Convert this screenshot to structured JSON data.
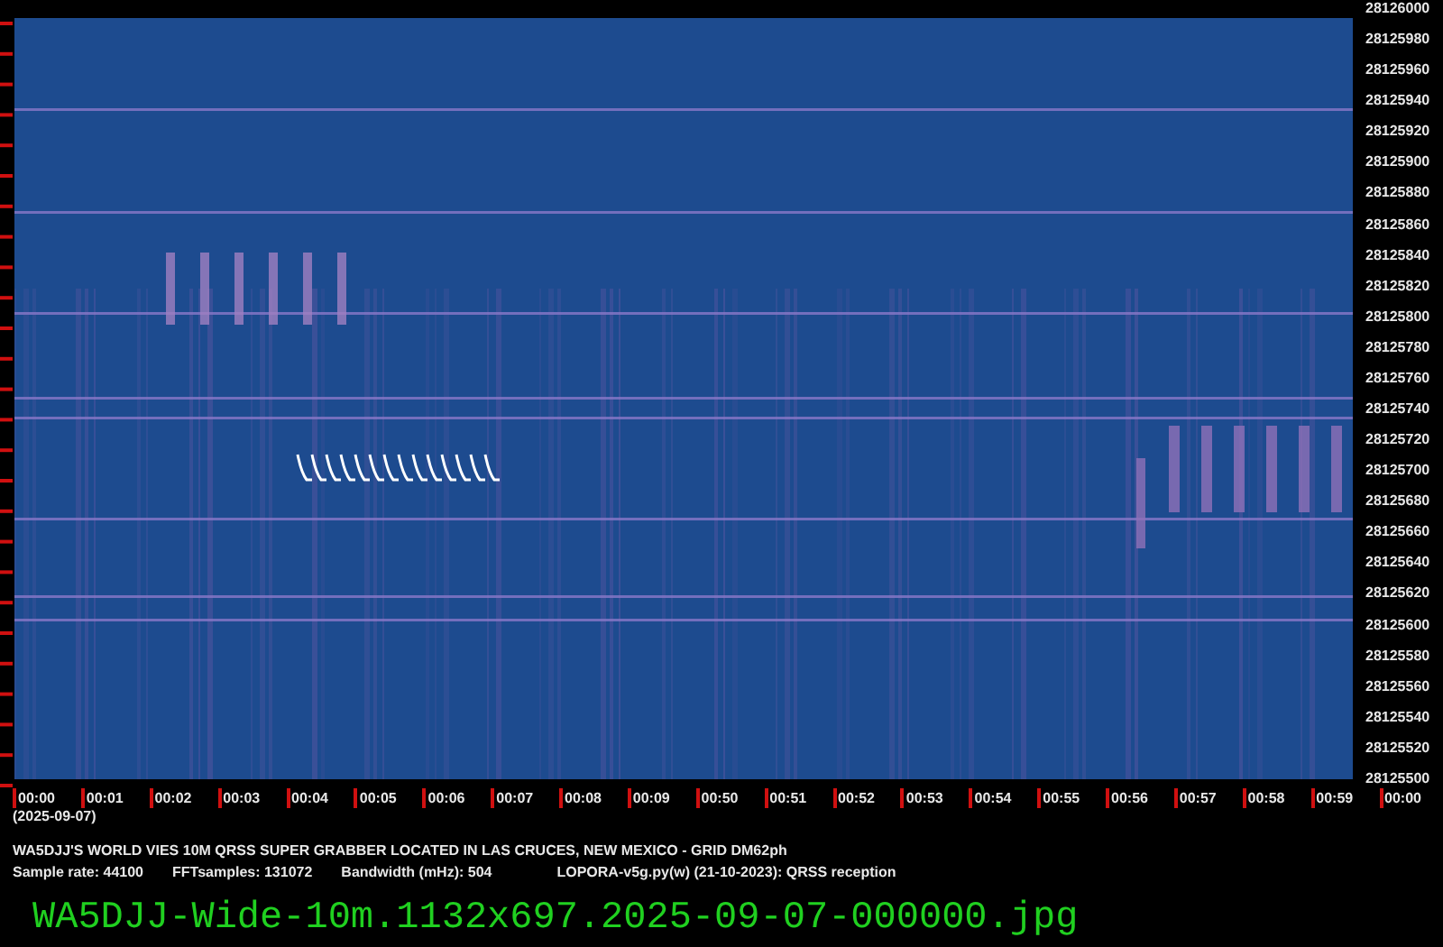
{
  "y_axis_labels": [
    "28126000",
    "28125980",
    "28125960",
    "28125940",
    "28125920",
    "28125900",
    "28125880",
    "28125860",
    "28125840",
    "28125820",
    "28125800",
    "28125780",
    "28125760",
    "28125740",
    "28125720",
    "28125700",
    "28125680",
    "28125660",
    "28125640",
    "28125620",
    "28125600",
    "28125580",
    "28125560",
    "28125540",
    "28125520",
    "28125500"
  ],
  "x_axis_labels": [
    "00:00",
    "00:01",
    "00:02",
    "00:03",
    "00:04",
    "00:05",
    "00:06",
    "00:07",
    "00:08",
    "00:09",
    "00:50",
    "00:51",
    "00:52",
    "00:53",
    "00:54",
    "00:55",
    "00:56",
    "00:57",
    "00:58",
    "00:59",
    "00:00"
  ],
  "date": "(2025-09-07)",
  "title": "WA5DJJ'S WORLD VIES 10M QRSS SUPER GRABBER LOCATED IN LAS CRUCES, NEW MEXICO - GRID DM62ph",
  "info": [
    "Sample rate: 44100",
    "FFTsamples: 131072",
    "Bandwidth (mHz): 504",
    "LOPORA-v5g.py(w) (21-10-2023): QRSS reception"
  ],
  "filename": "WA5DJJ-Wide-10m.1132x697.2025-09-07-000000.jpg"
}
